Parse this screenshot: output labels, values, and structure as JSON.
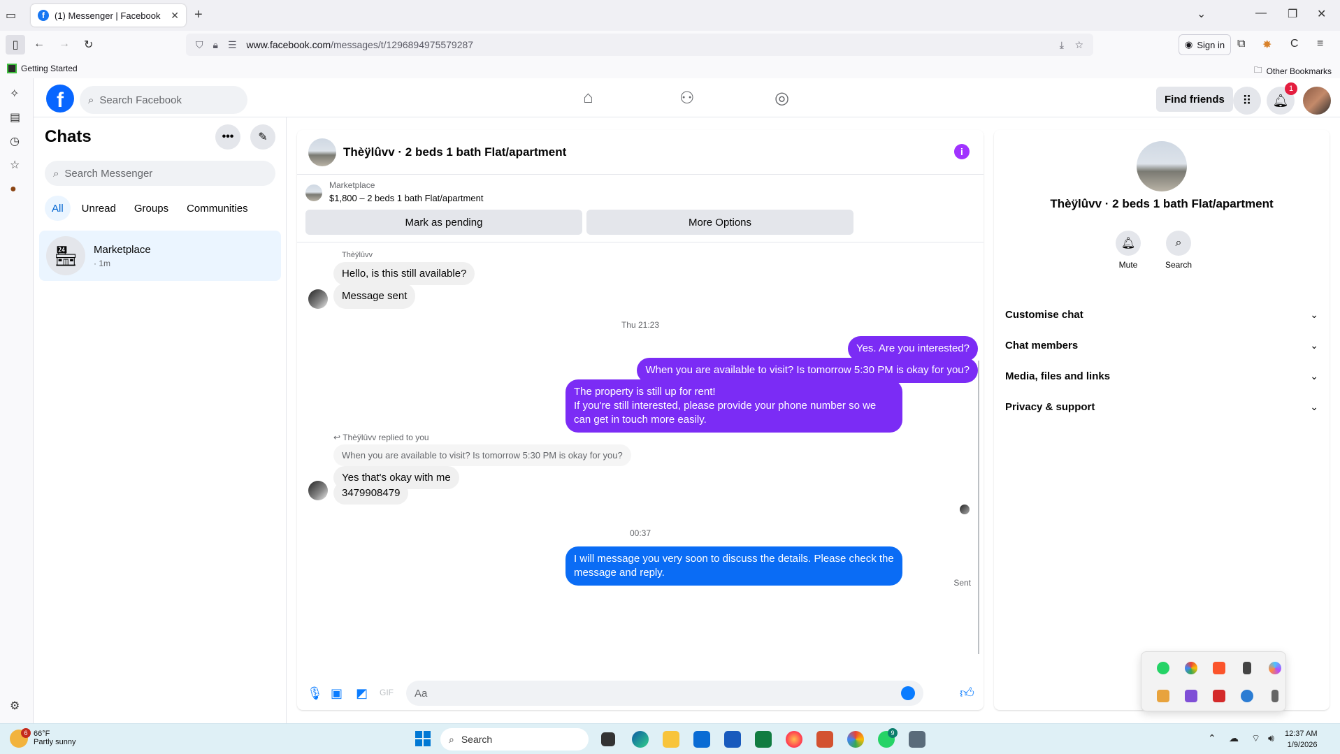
{
  "browser": {
    "tab_title": "(1) Messenger | Facebook",
    "url_domain": "www.facebook.com",
    "url_path": "/messages/t/1296894975579287",
    "signin_label": "Sign in",
    "bookmark_getting_started": "Getting Started",
    "bookmark_other": "Other Bookmarks"
  },
  "fb_header": {
    "search_placeholder": "Search Facebook",
    "find_friends": "Find friends",
    "notification_count": "1"
  },
  "chats": {
    "title": "Chats",
    "search_placeholder": "Search Messenger",
    "filters": [
      "All",
      "Unread",
      "Groups",
      "Communities"
    ],
    "conversation": {
      "name": "Marketplace",
      "time": "· 1m"
    }
  },
  "chat": {
    "title": "Thèÿlûvv · 2 beds 1 bath Flat/apartment",
    "listing_label": "Marketplace",
    "listing_price": "$1,800 – 2 beds 1 bath Flat/apartment",
    "mark_pending": "Mark as pending",
    "more_options": "More Options",
    "sender_name": "Thèÿlûvv",
    "msg_in_1": "Hello, is this still available?",
    "msg_in_2": "Message sent",
    "timestamp_1": "Thu 21:23",
    "msg_out_1": "Yes. Are you interested?",
    "msg_out_2": "When you are available to visit? Is tomorrow 5:30 PM is okay for you?",
    "msg_out_3_line1": "The property is still up for rent!",
    "msg_out_3_line2": "If you're still interested, please provide your phone number so we can get in touch more easily.",
    "replied_label": "Thèÿlûvv replied to you",
    "quoted": "When you are available to visit? Is tomorrow 5:30 PM is okay for you?",
    "msg_in_3": "Yes that's okay with me",
    "msg_in_4": "3479908479",
    "timestamp_2": "00:37",
    "msg_out_4": "I will message you very soon to discuss the details. Please check the message and reply.",
    "sent_label": "Sent",
    "composer_placeholder": "Aa"
  },
  "panel": {
    "name": "Thèÿlûvv · 2 beds 1 bath Flat/apartment",
    "mute": "Mute",
    "search": "Search",
    "rows": [
      "Customise chat",
      "Chat members",
      "Media, files and links",
      "Privacy & support"
    ]
  },
  "taskbar": {
    "temp": "66°F",
    "condition": "Partly sunny",
    "weather_badge": "6",
    "search_label": "Search",
    "whatsapp_badge": "9",
    "time": "12:37 AM",
    "date": "1/9/2026"
  },
  "colors": {
    "facebook_blue": "#0866ff",
    "outgoing_purple": "#7b2cf5",
    "outgoing_blue": "#0a6cf5",
    "active_filter": "#0064d1"
  }
}
